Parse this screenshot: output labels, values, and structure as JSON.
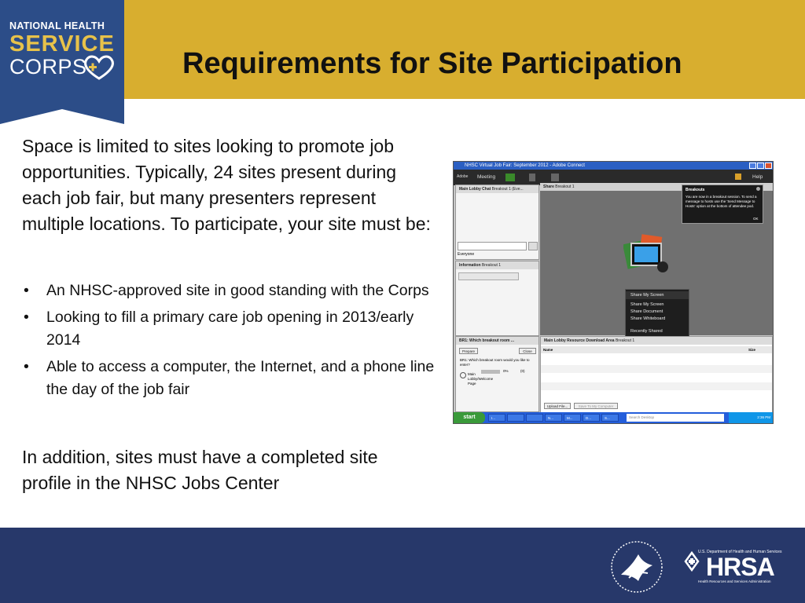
{
  "logo": {
    "line1": "NATIONAL HEALTH",
    "line2": "SERVICE",
    "line3": "CORPS",
    "heart_icon": "heart-plus-icon"
  },
  "slide": {
    "title": "Requirements for Site Participation",
    "intro": "Space is limited to sites looking to promote job opportunities. Typically, 24 sites present during each job fair, but many presenters represent multiple locations. To participate, your site must be:",
    "bullets": [
      "An NHSC-approved site in good standing with the Corps",
      "Looking to fill a primary care job opening in 2013/early 2014",
      "Able to access a computer, the Internet, and a phone line the day of the job fair"
    ],
    "bullet_glyph": "•",
    "outro": "In addition, sites must have a completed site profile in the NHSC Jobs Center"
  },
  "screenshot": {
    "window_title": "NHSC Virtual Job Fair: September 2012 - Adobe Connect",
    "menu": {
      "app": "Adobe",
      "meeting": "Meeting",
      "help": "Help"
    },
    "chat_pane": {
      "title": "Main Lobby Chat",
      "subtitle": "Breakout 1 (Eve...",
      "tab": "Everyone"
    },
    "info_pane": {
      "title": "Information",
      "subtitle": "Breakout 1"
    },
    "poll_pane": {
      "title": "BR1: Which breakout room ...",
      "prepare": "Prepare",
      "close": "Close",
      "question": "BR1: Which breakout room would you like to enter?",
      "option": "Main Lobby/Welcome Page",
      "percent": "0%",
      "count": "(0)"
    },
    "share_pane": {
      "title": "Share",
      "subtitle": "Breakout 1"
    },
    "popup": {
      "title": "Breakouts",
      "text": "You are now in a breakout session. To send a message to hosts use the 'Send Message to Hosts' option at the bottom of attendee pod.",
      "ok": "OK"
    },
    "share_menu": {
      "header": "Share My Screen",
      "items": [
        "Share My Screen",
        "Share Document",
        "Share Whiteboard"
      ],
      "recent": "Recently Shared"
    },
    "download_pane": {
      "title": "Main Lobby Resource Download Area",
      "subtitle": "Breakout 1",
      "col_name": "Name",
      "col_size": "Size",
      "upload": "Upload File...",
      "save": "Save To My Computer"
    },
    "taskbar": {
      "start": "start",
      "search": "Search Desktop",
      "clock": "2:36 PM",
      "tasks": [
        "I...",
        "",
        "",
        "N...",
        "M...",
        "D...",
        "S..."
      ]
    }
  },
  "footer": {
    "hhs_icon": "hhs-eagle-seal-icon",
    "hrsa_icon": "hrsa-logo-icon",
    "hrsa_dept": "U.S. Department of Health and Human Services",
    "hrsa_word": "HRSA",
    "hrsa_sub": "Health Resources and Services Administration"
  },
  "colors": {
    "header_gold": "#d8ae2f",
    "logo_blue": "#2c4d88",
    "footer_navy": "#27386a",
    "logo_gold": "#e7c24a"
  }
}
